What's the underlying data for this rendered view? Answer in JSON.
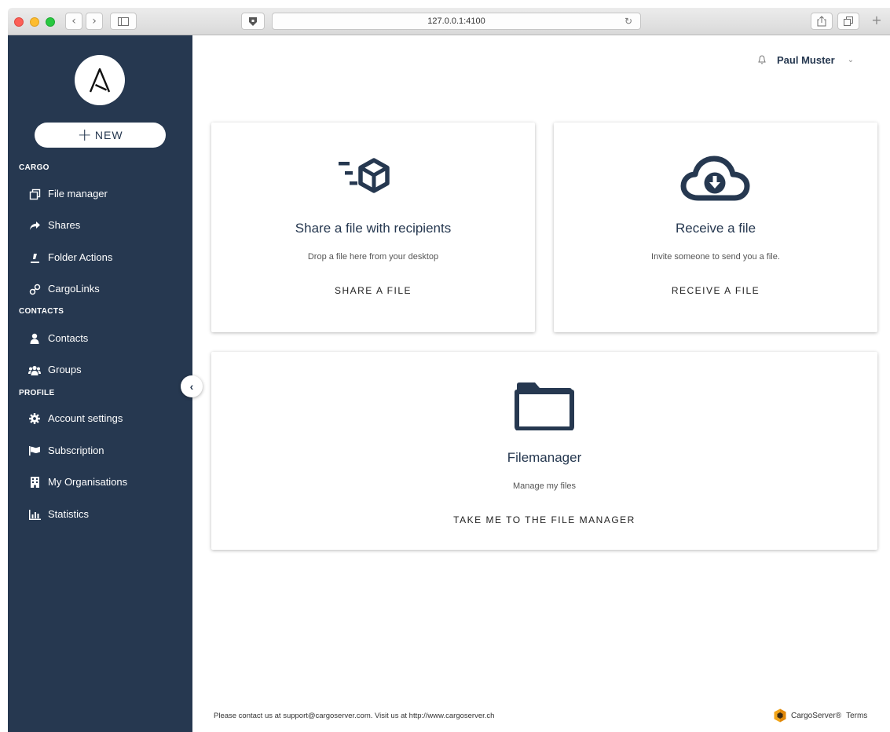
{
  "browser": {
    "url": "127.0.0.1:4100"
  },
  "sidebar": {
    "new_button": "NEW",
    "sections": [
      {
        "title": "CARGO",
        "items": [
          {
            "label": "File manager",
            "icon": "file-manager-icon"
          },
          {
            "label": "Shares",
            "icon": "share-arrow-icon"
          },
          {
            "label": "Folder Actions",
            "icon": "folder-actions-icon"
          },
          {
            "label": "CargoLinks",
            "icon": "link-icon"
          }
        ]
      },
      {
        "title": "CONTACTS",
        "items": [
          {
            "label": "Contacts",
            "icon": "user-icon"
          },
          {
            "label": "Groups",
            "icon": "users-icon"
          }
        ]
      },
      {
        "title": "PROFILE",
        "items": [
          {
            "label": "Account settings",
            "icon": "gear-icon"
          },
          {
            "label": "Subscription",
            "icon": "flag-icon"
          },
          {
            "label": "My Organisations",
            "icon": "building-icon"
          },
          {
            "label": "Statistics",
            "icon": "bar-chart-icon"
          }
        ]
      }
    ],
    "collapse_glyph": "‹"
  },
  "header": {
    "user_name": "Paul Muster"
  },
  "cards": {
    "share": {
      "title": "Share a file with recipients",
      "subtitle": "Drop a file here from your desktop",
      "action": "SHARE A FILE",
      "icon": "fast-package-icon"
    },
    "receive": {
      "title": "Receive a file",
      "subtitle": "Invite someone to send you a file.",
      "action": "RECEIVE A FILE",
      "icon": "cloud-download-icon"
    },
    "filemanager": {
      "title": "Filemanager",
      "subtitle": "Manage my files",
      "action": "TAKE ME TO THE FILE MANAGER",
      "icon": "folder-icon"
    }
  },
  "footer": {
    "contact_text": "Please contact us at support@cargoserver.com. Visit us at http://www.cargoserver.ch",
    "brand": "CargoServer®",
    "terms": "Terms"
  },
  "colors": {
    "sidebar_bg": "#263850",
    "accent": "#263850"
  }
}
